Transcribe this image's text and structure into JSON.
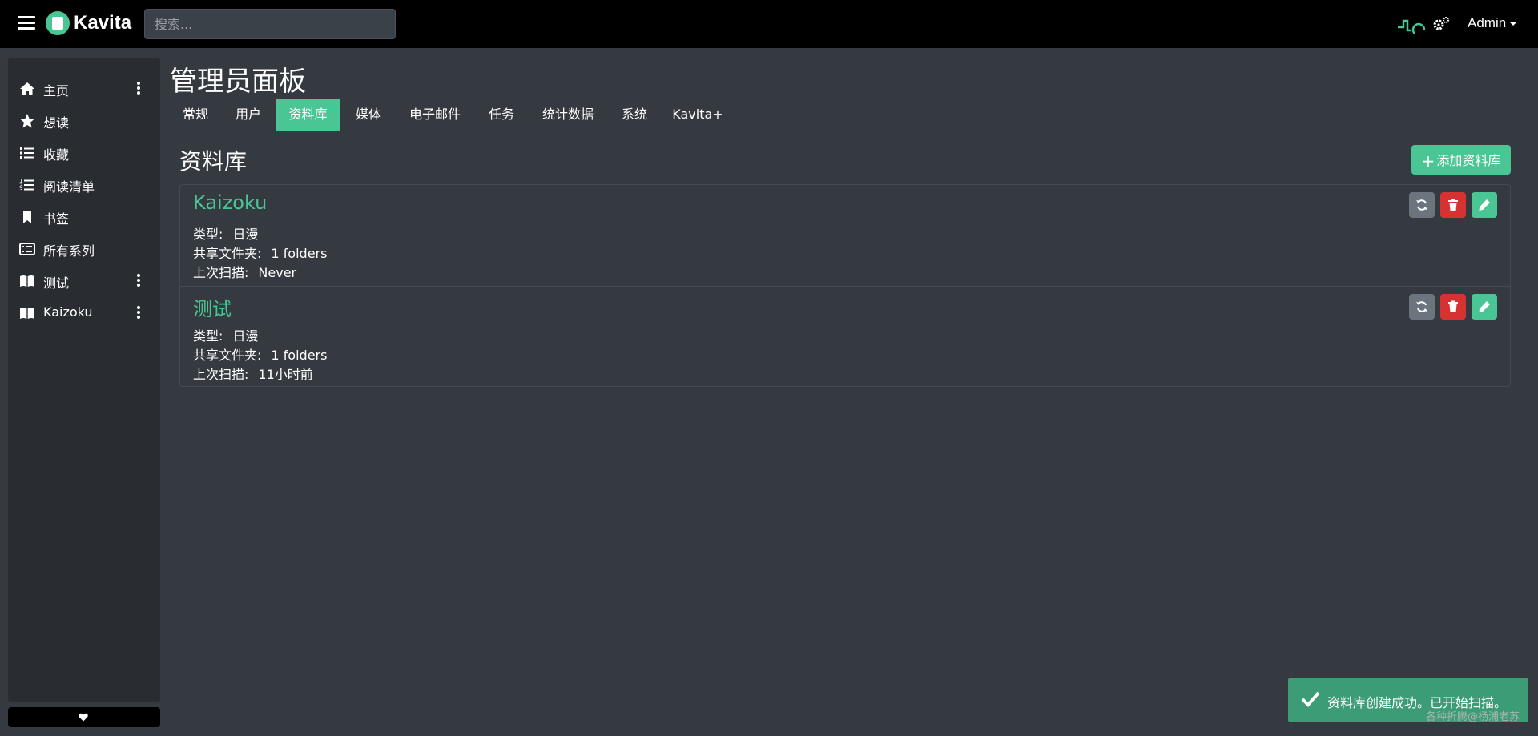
{
  "header": {
    "brand": "Kavita",
    "search_placeholder": "搜索...",
    "user": "Admin"
  },
  "sidebar": {
    "items": [
      {
        "label": "主页",
        "icon": "home-icon",
        "menu": true
      },
      {
        "label": "想读",
        "icon": "star-icon",
        "menu": false
      },
      {
        "label": "收藏",
        "icon": "list-icon",
        "menu": false
      },
      {
        "label": "阅读清单",
        "icon": "ordered-list-icon",
        "menu": false
      },
      {
        "label": "书签",
        "icon": "bookmark-icon",
        "menu": false
      },
      {
        "label": "所有系列",
        "icon": "series-list-icon",
        "menu": false
      },
      {
        "label": "测试",
        "icon": "book-open-icon",
        "menu": true
      },
      {
        "label": "Kaizoku",
        "icon": "book-open-icon",
        "menu": true
      }
    ]
  },
  "main": {
    "title": "管理员面板",
    "tabs": [
      "常规",
      "用户",
      "资料库",
      "媒体",
      "电子邮件",
      "任务",
      "统计数据",
      "系统",
      "Kavita+"
    ],
    "active_tab": "资料库",
    "section_title": "资料库",
    "add_button": "添加资料库",
    "field_labels": {
      "type": "类型:",
      "shared_folders": "共享文件夹:",
      "last_scan": "上次扫描:"
    },
    "libraries": [
      {
        "name": "Kaizoku",
        "type": "日漫",
        "folders": "1 folders",
        "last_scan": "Never"
      },
      {
        "name": "测试",
        "type": "日漫",
        "folders": "1 folders",
        "last_scan": "11小时前"
      }
    ]
  },
  "toast": {
    "message": "资料库创建成功。已开始扫描。"
  },
  "watermark": "各种折腾@杨浦老苏",
  "colors": {
    "accent": "#4ac694",
    "background": "#343a40",
    "topbar": "#000000",
    "sidebar": "#292d32",
    "danger": "#d63232",
    "secondary": "#6c757d",
    "toast": "#3c9c76"
  }
}
